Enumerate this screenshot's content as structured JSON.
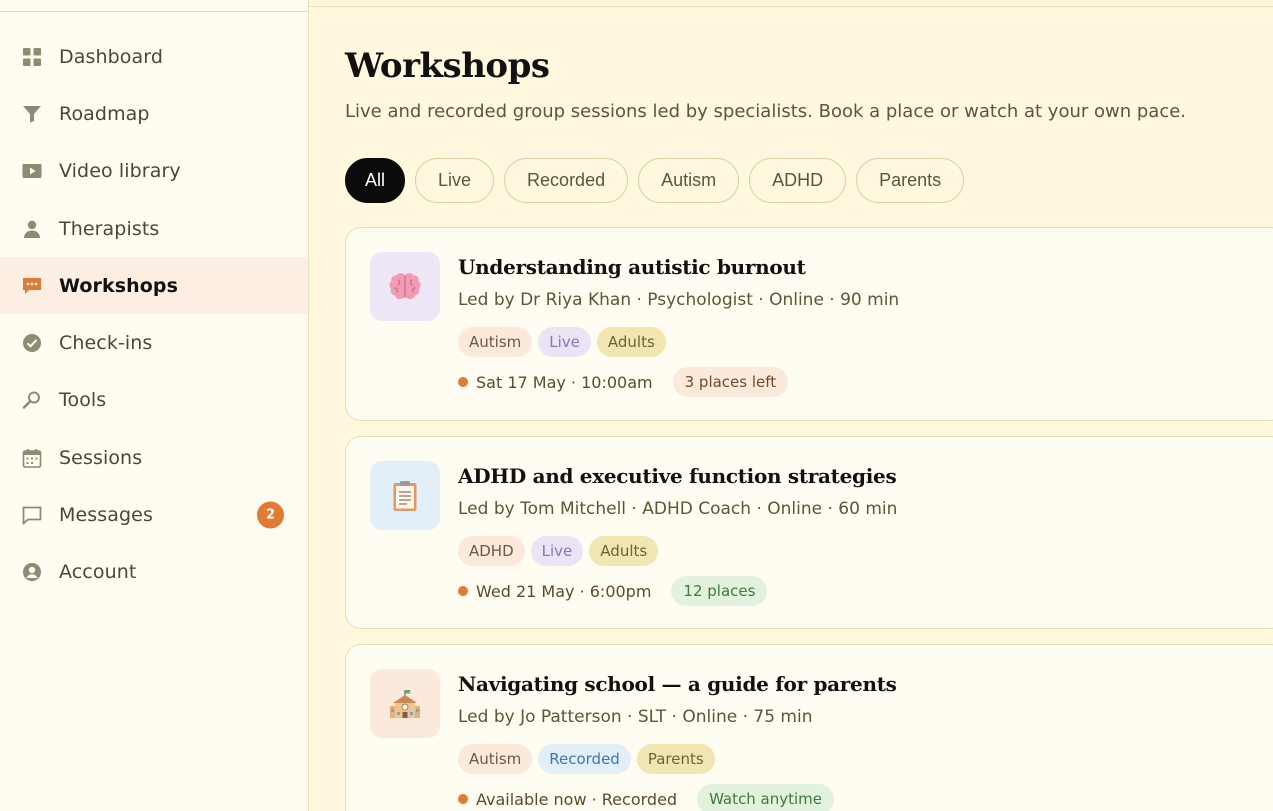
{
  "sidebar": {
    "items": [
      {
        "label": "Dashboard",
        "icon": "grid-icon"
      },
      {
        "label": "Roadmap",
        "icon": "funnel-icon"
      },
      {
        "label": "Video library",
        "icon": "play-icon"
      },
      {
        "label": "Therapists",
        "icon": "person-icon"
      },
      {
        "label": "Workshops",
        "icon": "chat-dots-icon",
        "active": true
      },
      {
        "label": "Check-ins",
        "icon": "check-circle-icon"
      },
      {
        "label": "Tools",
        "icon": "magnifier-icon"
      },
      {
        "label": "Sessions",
        "icon": "calendar-icon"
      },
      {
        "label": "Messages",
        "icon": "message-icon",
        "badge": "2"
      },
      {
        "label": "Account",
        "icon": "account-icon"
      }
    ]
  },
  "main": {
    "title": "Workshops",
    "subtitle": "Live and recorded group sessions led by specialists. Book a place or watch at your own pace.",
    "filters": [
      "All",
      "Live",
      "Recorded",
      "Autism",
      "ADHD",
      "Parents"
    ],
    "active_filter": "All",
    "workshops": [
      {
        "icon": "brain-icon",
        "title": "Understanding autistic burnout",
        "meta": "Led by Dr Riya Khan · Psychologist · Online · 90 min",
        "tags": [
          "Autism",
          "Live",
          "Adults"
        ],
        "when": "Sat 17 May · 10:00am",
        "availability": "3 places left"
      },
      {
        "icon": "clipboard-icon",
        "title": "ADHD and executive function strategies",
        "meta": "Led by Tom Mitchell · ADHD Coach · Online · 60 min",
        "tags": [
          "ADHD",
          "Live",
          "Adults"
        ],
        "when": "Wed 21 May · 6:00pm",
        "availability": "12 places"
      },
      {
        "icon": "school-icon",
        "title": "Navigating school — a guide for parents",
        "meta": "Led by Jo Patterson · SLT · Online · 75 min",
        "tags": [
          "Autism",
          "Recorded",
          "Parents"
        ],
        "when": "Available now · Recorded",
        "availability": "Watch anytime"
      }
    ]
  },
  "colors": {
    "accent": "#E07A34",
    "background": "#FFF8DF",
    "sidebar_bg": "#FFFDF1",
    "active_nav_bg": "#FCEEE2"
  }
}
